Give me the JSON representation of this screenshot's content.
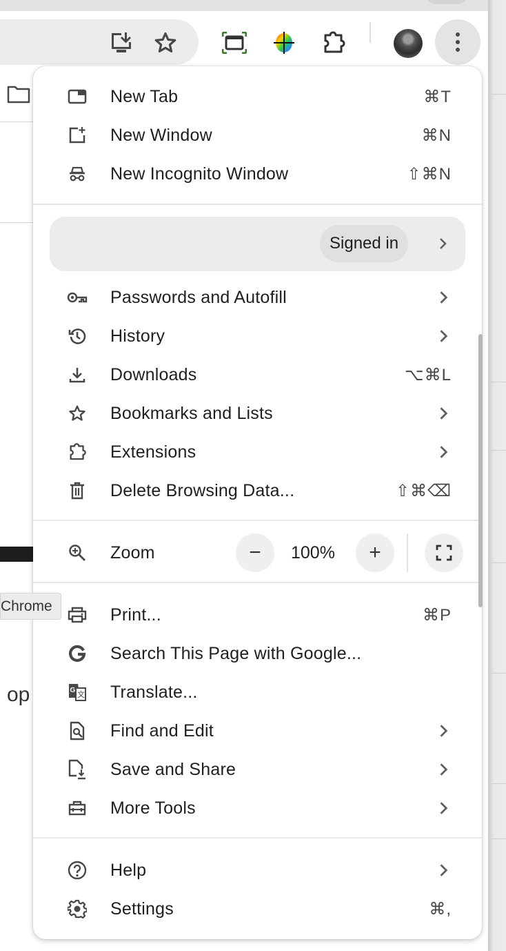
{
  "toolbar": {
    "icons": [
      "install-app-icon",
      "bookmark-star-icon",
      "screen-capture-icon",
      "color-picker-icon",
      "extensions-icon",
      "profile-avatar",
      "more-menu-icon"
    ]
  },
  "background": {
    "tooltip": "Chrome",
    "partial_text": "op"
  },
  "menu": {
    "new_tab": {
      "label": "New Tab",
      "shortcut": "⌘T",
      "icon": "new-tab-icon"
    },
    "new_window": {
      "label": "New Window",
      "shortcut": "⌘N",
      "icon": "new-window-icon"
    },
    "new_incognito": {
      "label": "New Incognito Window",
      "shortcut": "⇧⌘N",
      "icon": "incognito-icon"
    },
    "profile": {
      "status": "Signed in"
    },
    "passwords": {
      "label": "Passwords and Autofill",
      "icon": "key-icon",
      "submenu": true
    },
    "history": {
      "label": "History",
      "icon": "history-icon",
      "submenu": true
    },
    "downloads": {
      "label": "Downloads",
      "shortcut": "⌥⌘L",
      "icon": "download-icon"
    },
    "bookmarks": {
      "label": "Bookmarks and Lists",
      "icon": "star-icon",
      "submenu": true
    },
    "extensions": {
      "label": "Extensions",
      "icon": "puzzle-icon",
      "submenu": true
    },
    "delete_data": {
      "label": "Delete Browsing Data...",
      "shortcut": "⇧⌘⌫",
      "icon": "trash-icon"
    },
    "zoom": {
      "label": "Zoom",
      "value": "100%",
      "minus": "−",
      "plus": "+",
      "icon": "zoom-in-icon"
    },
    "print": {
      "label": "Print...",
      "shortcut": "⌘P",
      "icon": "print-icon"
    },
    "search_google": {
      "label": "Search This Page with Google...",
      "icon": "google-g-icon"
    },
    "translate": {
      "label": "Translate...",
      "icon": "translate-icon"
    },
    "find_edit": {
      "label": "Find and Edit",
      "icon": "find-in-page-icon",
      "submenu": true
    },
    "save_share": {
      "label": "Save and Share",
      "icon": "save-page-icon",
      "submenu": true
    },
    "more_tools": {
      "label": "More Tools",
      "icon": "toolbox-icon",
      "submenu": true
    },
    "help": {
      "label": "Help",
      "icon": "help-icon",
      "submenu": true
    },
    "settings": {
      "label": "Settings",
      "shortcut": "⌘,",
      "icon": "gear-icon"
    }
  }
}
